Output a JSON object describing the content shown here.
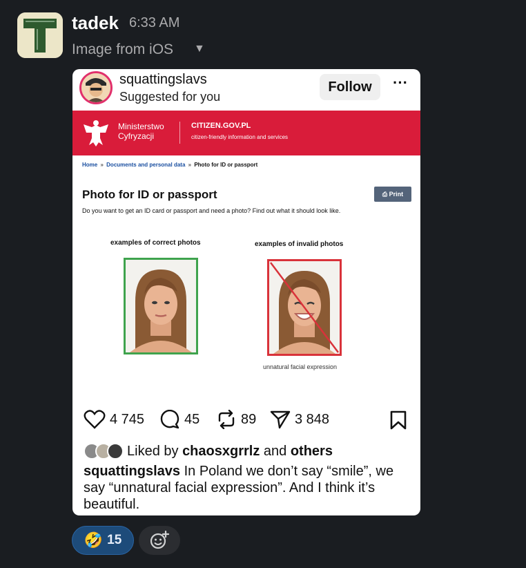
{
  "message": {
    "user": "tadek",
    "time": "6:33 AM",
    "file_label": "Image from iOS",
    "caret": "▼"
  },
  "post": {
    "username": "squattingslavs",
    "subtitle": "Suggested for you",
    "follow": "Follow",
    "more": "···",
    "site": {
      "ministry": "Ministerstwo\nCyfryzacji",
      "domain": "CITIZEN.GOV.PL",
      "tagline": "citizen-friendly information and services",
      "breadcrumb": [
        "Home",
        "Documents and personal data",
        "Photo for ID or passport"
      ],
      "breadcrumb_sep": "»",
      "title": "Photo for ID or passport",
      "print": "Print",
      "intro": "Do you want to get an ID card or passport and need a photo? Find out what it should look like.",
      "correct_label": "examples of correct photos",
      "invalid_label": "examples of invalid photos",
      "invalid_caption": "unnatural facial expression"
    },
    "likes": "4 745",
    "comments": "45",
    "reposts": "89",
    "shares": "3 848",
    "liked_by_prefix": "Liked by",
    "liked_by_user": "chaosxgrrlz",
    "liked_by_and": "and",
    "liked_by_others": "others",
    "caption_user": "squattingslavs",
    "caption_text": "In Poland we don’t say “smile”, we say “unnatural facial expression”. And I think it’s beautiful."
  },
  "reaction": {
    "emoji": "🤣",
    "count": "15"
  },
  "colors": {
    "background": "#1a1d21",
    "gov_red": "#d91c3a",
    "valid_green": "#3fa34d",
    "invalid_red": "#d9323a",
    "reaction_blue": "#1d4b7a"
  }
}
